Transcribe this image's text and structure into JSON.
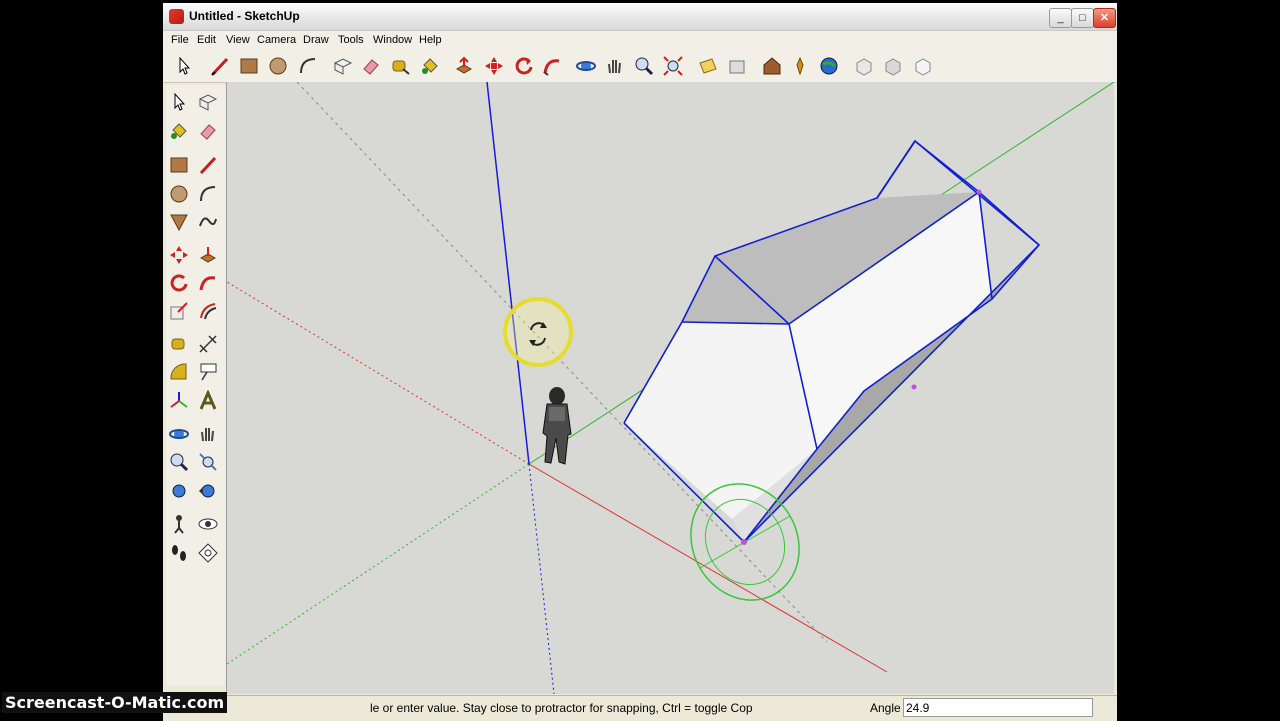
{
  "window": {
    "title": "Untitled - SketchUp"
  },
  "menu": [
    "File",
    "Edit",
    "View",
    "Camera",
    "Draw",
    "Tools",
    "Window",
    "Help"
  ],
  "toolbar": {
    "tools": [
      "select-icon",
      "line-icon",
      "rectangle-icon",
      "circle-icon",
      "arc-icon",
      "make-component-icon",
      "eraser-icon",
      "tape-measure-icon",
      "paint-bucket-icon",
      "push-pull-icon",
      "move-icon",
      "rotate-icon",
      "follow-me-icon",
      "orbit-icon",
      "pan-icon",
      "zoom-icon",
      "zoom-extents-icon",
      "section-plane-icon",
      "section-fill-icon",
      "warehouse-icon",
      "components-icon",
      "google-earth-icon",
      "style-1-icon",
      "style-2-icon",
      "style-3-icon"
    ]
  },
  "left_toolbar": {
    "tools": [
      "select-icon",
      "make-component-icon",
      "paint-bucket-icon",
      "eraser-icon",
      "rectangle-icon",
      "line-icon",
      "circle-icon",
      "arc-icon",
      "polygon-icon",
      "freehand-icon",
      "move-icon",
      "push-pull-icon",
      "rotate-icon",
      "follow-me-icon",
      "scale-icon",
      "offset-icon",
      "tape-measure-icon",
      "dimension-icon",
      "protractor-icon",
      "text-icon",
      "axes-icon",
      "3d-text-icon",
      "orbit-icon",
      "pan-icon",
      "zoom-icon",
      "zoom-window-icon",
      "zoom-extents-icon",
      "previous-view-icon",
      "position-camera-icon",
      "look-around-icon",
      "walk-icon",
      "section-plane-icon"
    ]
  },
  "status": {
    "message": "le or enter value.  Stay close to protractor for snapping, Ctrl = toggle Cop",
    "vcb_label": "Angle",
    "vcb_value": "24.9"
  },
  "watermark": "Screencast-O-Matic.com",
  "colors": {
    "axis_red": "#e03030",
    "axis_green": "#2fb52f",
    "axis_blue": "#1a1ae0",
    "protractor": "#38c838",
    "edge": "#1020d0"
  }
}
